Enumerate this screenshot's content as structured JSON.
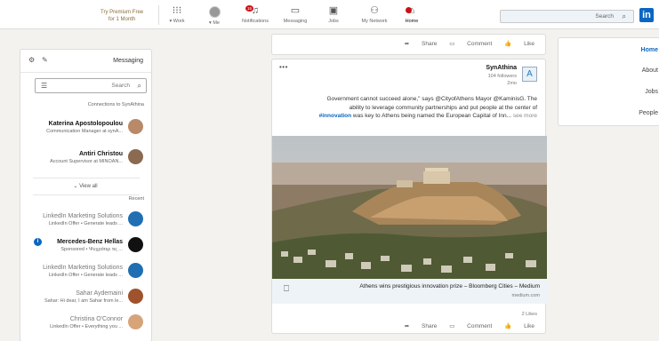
{
  "topbar": {
    "search_placeholder": "Search",
    "nav": [
      {
        "label": "Home",
        "icon": "home-icon"
      },
      {
        "label": "My Network",
        "icon": "network-icon"
      },
      {
        "label": "Jobs",
        "icon": "briefcase-icon"
      },
      {
        "label": "Messaging",
        "icon": "chat-icon"
      },
      {
        "label": "Notifications",
        "icon": "bell-icon",
        "badge": "15"
      },
      {
        "label": "Me",
        "icon": "avatar"
      },
      {
        "label": "Work",
        "icon": "grid-icon"
      }
    ],
    "premium_line1": "Try Premium Free",
    "premium_line2": "for 1 Month"
  },
  "messaging": {
    "title": "Messaging",
    "search_placeholder": "Search",
    "connections_label": "Connections to SynAthina",
    "connections": [
      {
        "name": "Katerina Apostolopoulou",
        "subtitle": "Communication Manager at synA..."
      },
      {
        "name": "Antiri Christou",
        "subtitle": "Account Supervisor at MINOAN..."
      }
    ],
    "view_all": "View all",
    "recent_label": "Recent",
    "recent": [
      {
        "name": "LinkedIn Marketing Solutions",
        "subtitle": "LinkedIn Offer • Generate leads ..."
      },
      {
        "name": "Mercedes-Benz Hellas",
        "subtitle": "Sponsored • Ψυχρότερ τις ..."
      },
      {
        "name": "LinkedIn Marketing Solutions",
        "subtitle": "LinkedIn Offer • Generate leads ..."
      },
      {
        "name": "Sahar Aydemaini",
        "subtitle": "Sahar: Hi dear, I am Sahar from le..."
      },
      {
        "name": "Christina O'Connor",
        "subtitle": "LinkedIn Offer • Everything you ..."
      }
    ]
  },
  "feed": {
    "top_actions": {
      "like": "Like",
      "comment": "Comment",
      "share": "Share"
    },
    "post": {
      "author": "SynAthina",
      "followers": "104 followers",
      "time": "2mo",
      "text_line1": "Government cannot succeed alone,\" says @CityofAthens Mayor @KaminisG. The",
      "text_line2": "ability to leverage community partnerships and put people at the center of",
      "text_hashtag": "#innovation",
      "text_line3": " was key to Athens being named the European Capital of Inn...",
      "see_more": "see more",
      "link_title": "Athens wins prestigious innovation prize – Bloomberg Cities – Medium",
      "link_source": "medium.com",
      "likes": "2 Likes",
      "actions": {
        "like": "Like",
        "comment": "Comment",
        "share": "Share"
      }
    }
  },
  "right_nav": {
    "items": [
      "Home",
      "About",
      "Jobs",
      "People"
    ],
    "active": "Home"
  }
}
